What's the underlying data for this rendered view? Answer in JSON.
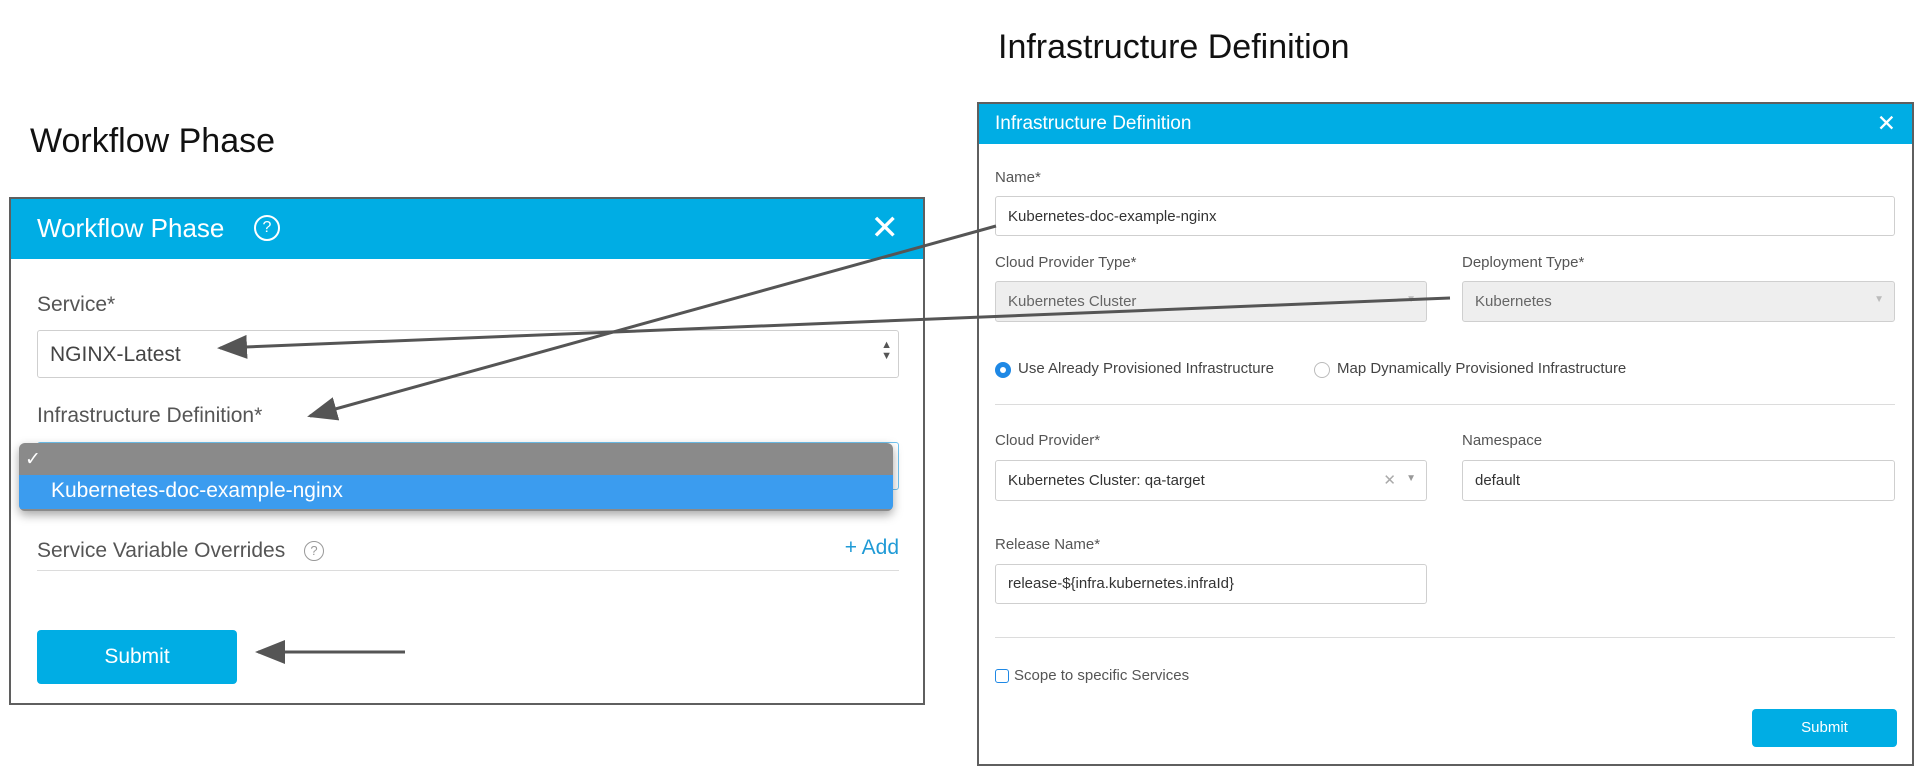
{
  "captions": {
    "left": "Workflow Phase",
    "right": "Infrastructure Definition"
  },
  "workflow_phase": {
    "title": "Workflow Phase",
    "service_label": "Service*",
    "service_value": "NGINX-Latest",
    "infra_label": "Infrastructure Definition*",
    "dropdown_check": "✓",
    "dropdown_option": "Kubernetes-doc-example-nginx",
    "overrides_label": "Service Variable Overrides",
    "add_label": "+ Add",
    "submit_label": "Submit"
  },
  "infra_def": {
    "title": "Infrastructure Definition",
    "name_label": "Name*",
    "name_value": "Kubernetes-doc-example-nginx",
    "cloud_provider_type_label": "Cloud Provider Type*",
    "cloud_provider_type_value": "Kubernetes Cluster",
    "deployment_type_label": "Deployment Type*",
    "deployment_type_value": "Kubernetes",
    "radio_provisioned": "Use Already Provisioned Infrastructure",
    "radio_dynamic": "Map Dynamically Provisioned Infrastructure",
    "cloud_provider_label": "Cloud Provider*",
    "cloud_provider_value": "Kubernetes Cluster: qa-target",
    "namespace_label": "Namespace",
    "namespace_value": "default",
    "release_name_label": "Release Name*",
    "release_name_value": "release-${infra.kubernetes.infraId}",
    "scope_label": "Scope to specific Services",
    "submit_label": "Submit"
  },
  "colors": {
    "accent": "#00ade4",
    "dropdown_selected": "#3b9cef",
    "dropdown_bg": "#8a8a8a",
    "arrow": "#555555"
  }
}
